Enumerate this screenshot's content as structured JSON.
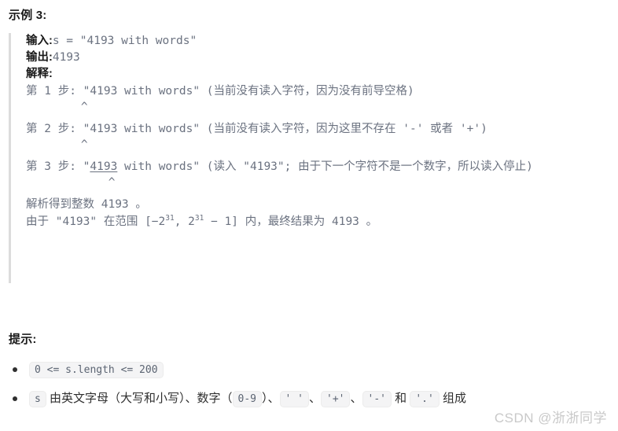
{
  "example": {
    "heading": "示例 3:",
    "input_label": "输入:",
    "input_value": "s = \"4193 with words\"",
    "output_label": "输出:",
    "output_value": "4193",
    "explain_label": "解释:",
    "steps": [
      {
        "prefix": "第 1 步: \"",
        "highlight": "",
        "rest": "4193 with words\" (当前没有读入字符，因为没有前导空格)",
        "caret_indent": "        ",
        "caret": "^"
      },
      {
        "prefix": "第 2 步: \"",
        "highlight": "",
        "rest": "4193 with words\" (当前没有读入字符，因为这里不存在 '-' 或者 '+')",
        "caret_indent": "        ",
        "caret": "^"
      },
      {
        "prefix": "第 3 步: \"",
        "highlight": "4193",
        "rest": " with words\" (读入 \"4193\"; 由于下一个字符不是一个数字，所以读入停止)",
        "caret_indent": "            ",
        "caret": "^"
      }
    ],
    "result_parse": "解析得到整数 4193 。",
    "result_range_a": "由于 \"4193\" 在范围 [−2",
    "result_exp1": "31",
    "result_range_b": ", 2",
    "result_exp2": "31",
    "result_range_c": " − 1] 内，最终结果为 4193 。"
  },
  "hints": {
    "heading": "提示:",
    "items": [
      {
        "kind": "code-only",
        "code": "0 <= s.length <= 200"
      },
      {
        "kind": "mixed",
        "lead_code": "s",
        "t1": " 由英文字母（大写和小写）、数字（",
        "c1": "0-9",
        "t2": "）、",
        "c2": "' '",
        "t3": "、",
        "c3": "'+'",
        "t4": "、",
        "c4": "'-'",
        "t5": " 和 ",
        "c5": "'.'",
        "t6": " 组成"
      }
    ]
  },
  "watermark": "CSDN @浙浙同学",
  "colors": {
    "text": "#2f2f2f",
    "muted": "#6b7280",
    "heading": "#1a1a1a",
    "chip_bg": "#f4f4f5",
    "quote_border": "#dcdcdc",
    "watermark": "#c9c9c9"
  }
}
